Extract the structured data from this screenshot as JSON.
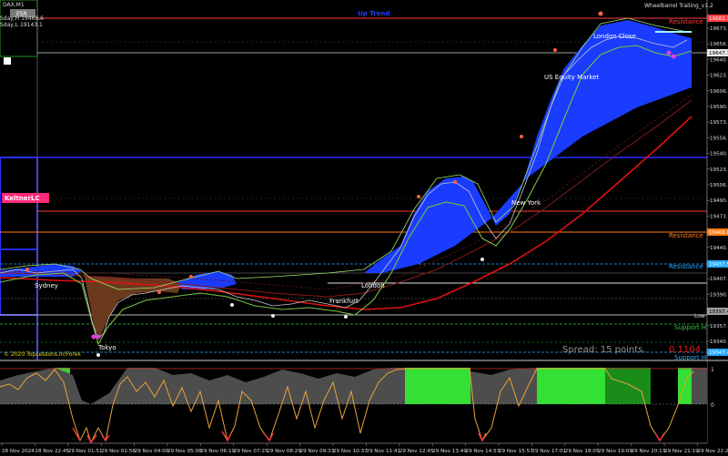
{
  "window": {
    "symbol_tf": "DAX,M1",
    "top_left_box": "ESR",
    "info_line_1": "Sday,H 19468.6",
    "info_line_2": "Sday,L 19143.1",
    "indicator_title": "Wheelbarrel Trailing_v1.2",
    "trend_label": "Up Trend",
    "keltner_label": "KeltnerLC",
    "copyright": "© 2020 TopLessons.In/Forex",
    "spread_text": "Spread: 15 points.",
    "spread_value": "0.1104",
    "low_label": "Low"
  },
  "sessions": [
    {
      "name": "Sydney"
    },
    {
      "name": "Tokyo"
    },
    {
      "name": "Frankfurt"
    },
    {
      "name": "London"
    },
    {
      "name": "New York"
    },
    {
      "name": "US Equity Market"
    },
    {
      "name": "London Close"
    }
  ],
  "levels": [
    {
      "name": "Resistance 1",
      "label": "Resistance",
      "color": "#ff3b3b"
    },
    {
      "name": "Resistance 2",
      "label": "Resistance",
      "color": "#ff7a1a"
    },
    {
      "name": "Resistance 3",
      "label": "Resistance",
      "color": "#27a9ff"
    },
    {
      "name": "Support 1",
      "label": "Support H",
      "color": "#2ecc40"
    },
    {
      "name": "Support 2",
      "label": "Support H",
      "color": "#27a9ff"
    }
  ],
  "price_axis": {
    "ticks": [
      "19673.0",
      "19656.5",
      "19640.0",
      "19623.5",
      "19606.5",
      "19590.0",
      "19573.5",
      "19556.5",
      "19540.0",
      "19523.5",
      "19506.5",
      "19490.0",
      "19473.5",
      "19456.5",
      "19440.0",
      "19423.5",
      "19407.0",
      "19390.0",
      "19373.5",
      "19357.0",
      "19340.5"
    ],
    "highlights": [
      {
        "text": "19682.3",
        "color": "#ff3b3b"
      },
      {
        "text": "19647.1",
        "color": "#e8e8e8"
      },
      {
        "text": "19466.8",
        "color": "#ff7a1a"
      },
      {
        "text": "19437.5",
        "color": "#27a9ff"
      },
      {
        "text": "19397.4",
        "color": "#9e9e9e"
      },
      {
        "text": "19347.4",
        "color": "#27a9ff"
      }
    ]
  },
  "sub_axis": {
    "ticks": [
      "1",
      "0"
    ]
  },
  "time_axis": {
    "ticks": [
      "28 Nov 2024",
      "28 Nov 22:45",
      "29 Nov 01:51",
      "29 Nov 02:56",
      "29 Nov 04:00",
      "29 Nov 05:08",
      "29 Nov 06:19",
      "29 Nov 07:25",
      "29 Nov 08:29",
      "29 Nov 09:33",
      "29 Nov 10:37",
      "29 Nov 11:41",
      "29 Nov 12:45",
      "29 Nov 13:49",
      "29 Nov 14:53",
      "29 Nov 15:57",
      "29 Nov 17:01",
      "29 Nov 18:05",
      "29 Nov 19:09",
      "29 Nov 20:13",
      "29 Nov 21:19",
      "29 Nov 22:23"
    ]
  },
  "colors": {
    "bullish_cloud": "#1a3cff",
    "bearish_cloud": "#6b3a1e",
    "slow_ma": "#e01010",
    "mid_ma": "#8b1a1a",
    "fast_ma": "#77c043",
    "oscillator_fill": "#4d4d4d",
    "oscillator_line": "#e8a33a",
    "green_zone": "#22b922"
  }
}
